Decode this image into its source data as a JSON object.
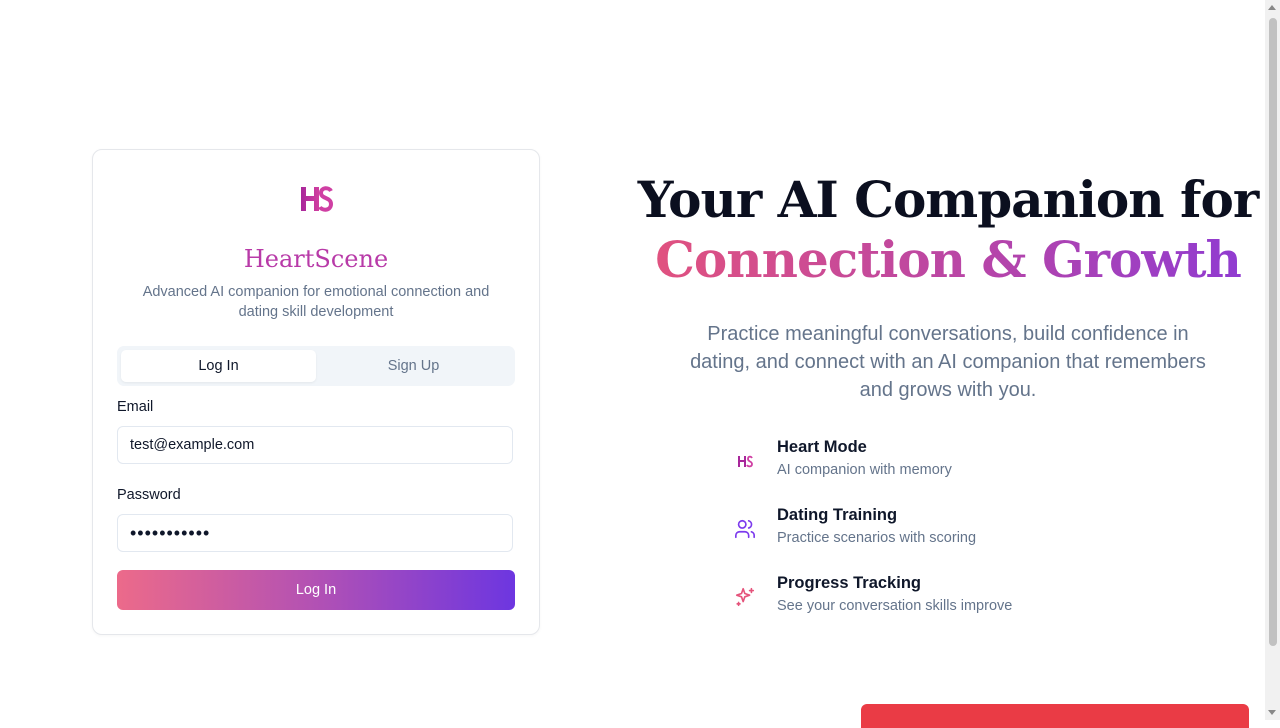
{
  "auth_card": {
    "logo_text": "HS",
    "brand": "HeartScene",
    "tagline": "Advanced AI companion for emotional connection and dating skill development",
    "tabs": [
      {
        "label": "Log In",
        "active": true
      },
      {
        "label": "Sign Up",
        "active": false
      }
    ],
    "email_label": "Email",
    "email_value": "test@example.com",
    "password_label": "Password",
    "password_value": "•••••••••••",
    "submit_label": "Log In"
  },
  "hero": {
    "title_line1": "Your AI Companion for",
    "title_line2": "Connection & Growth",
    "subtitle": "Practice meaningful conversations, build confidence in dating, and connect with an AI companion that remembers and grows with you.",
    "features": [
      {
        "icon": "hs-logo-icon",
        "title": "Heart Mode",
        "description": "AI companion with memory"
      },
      {
        "icon": "users-icon",
        "title": "Dating Training",
        "description": "Practice scenarios with scoring"
      },
      {
        "icon": "sparkles-icon",
        "title": "Progress Tracking",
        "description": "See your conversation skills improve"
      }
    ]
  },
  "colors": {
    "brand": "#b83aa8",
    "gradient_start": "#ec6a8a",
    "gradient_end": "#6d36e0",
    "banner": "#ea3b45"
  }
}
